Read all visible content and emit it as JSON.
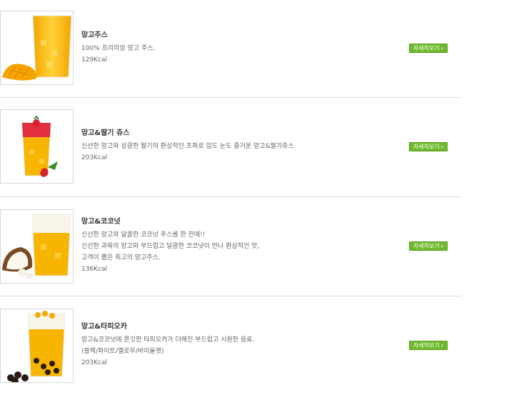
{
  "products": [
    {
      "name": "망고주스",
      "desc_lines": [
        "100% 프리미엄 망고 주스."
      ],
      "kcal": "129Kcal",
      "button": "자세히보기",
      "image_icon": "mango-juice-image"
    },
    {
      "name": "망고&딸기 쥬스",
      "desc_lines": [
        "신선한 망고와 상큼한 딸기의 환상적인 조화로 입도 눈도 즐거운 망고&딸기쥬스"
      ],
      "kcal": "203Kcal",
      "button": "자세히보기",
      "image_icon": "mango-strawberry-juice-image"
    },
    {
      "name": "망고&코코넛",
      "desc_lines": [
        "신선한 망고와 달콤한 코코넛 주스를 한 잔에!!",
        "신선한 과육의 망고와 부드럽고 달콤한 코코넛이 만나 환상적인 맛,",
        "고객이 뽑은 최고의 망고주스."
      ],
      "kcal": "136Kcal",
      "button": "자세히보기",
      "image_icon": "mango-coconut-juice-image"
    },
    {
      "name": "망고&타피오카",
      "desc_lines": [
        "망고&코코넛에 쫀깃한 타피오카가 더해진 부드럽고 시원한 음료.",
        "(블랙/화이트/옐로우/바이올렛)"
      ],
      "kcal": "203Kcal",
      "button": "자세히보기",
      "image_icon": "mango-tapioca-juice-image"
    }
  ],
  "colors": {
    "button_green": "#6fba2c",
    "mango": "#f7b500",
    "divider": "#dcdcdc"
  }
}
